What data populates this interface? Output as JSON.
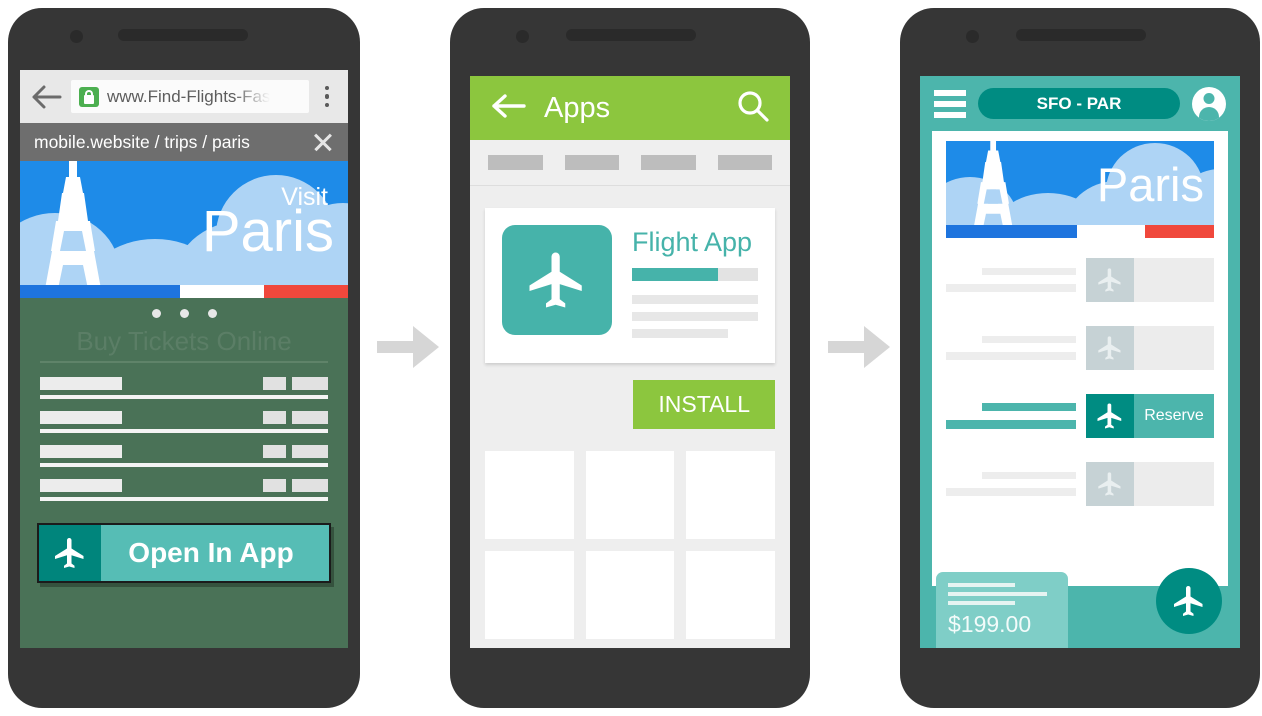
{
  "phone1": {
    "browser": {
      "back_icon": "back-arrow-icon",
      "lock_icon": "lock-icon",
      "url": "www.Find-Flights-Fas",
      "menu_icon": "overflow-menu-icon"
    },
    "banner": {
      "text": "mobile.website / trips / paris",
      "close_icon": "close-icon"
    },
    "hero": {
      "kicker": "Visit",
      "title": "Paris",
      "tower_icon": "eiffel-tower-icon",
      "flag_colors": [
        "#1E74DE",
        "#FFFFFF",
        "#F0483C"
      ]
    },
    "carousel_dots": 3,
    "section_title": "Buy Tickets Online",
    "list_rows": 4,
    "cta": {
      "label": "Open In App",
      "icon": "airplane-icon",
      "icon_bg": "#00857C",
      "body_bg": "#56BDB5"
    },
    "screen_bg": "#4a7257"
  },
  "phone2": {
    "appbar": {
      "back_icon": "back-arrow-icon",
      "title": "Apps",
      "search_icon": "search-icon",
      "bg": "#8CC63E"
    },
    "tabs": [
      "",
      "",
      "",
      ""
    ],
    "card": {
      "icon": "airplane-icon",
      "icon_bg": "#46B3AA",
      "app_name": "Flight App",
      "progress_percent": 68,
      "detail_lines": 3
    },
    "install_button": {
      "label": "INSTALL",
      "bg": "#8CC63E"
    },
    "grid_tiles": 6,
    "screen_bg": "#eeeeee"
  },
  "phone3": {
    "topbar": {
      "menu_icon": "hamburger-menu-icon",
      "route": "SFO - PAR",
      "avatar_icon": "account-avatar-icon",
      "bg": "#4CB5AC",
      "pill_bg": "#008C82"
    },
    "hero": {
      "title": "Paris",
      "tower_icon": "eiffel-tower-icon"
    },
    "flights": [
      {
        "button_label": "",
        "icon": "airplane-icon",
        "selected": false
      },
      {
        "button_label": "",
        "icon": "airplane-icon",
        "selected": false
      },
      {
        "button_label": "Reserve",
        "icon": "airplane-icon",
        "selected": true
      },
      {
        "button_label": "",
        "icon": "airplane-icon",
        "selected": false
      }
    ],
    "price_card": {
      "amount": "$199.00",
      "bg": "#7FCEC7"
    },
    "fab": {
      "icon": "airplane-icon",
      "bg": "#008C82"
    }
  },
  "flow": {
    "arrow1_icon": "right-arrow-icon",
    "arrow2_icon": "right-arrow-icon",
    "arrow_color": "#D6D6D6"
  }
}
